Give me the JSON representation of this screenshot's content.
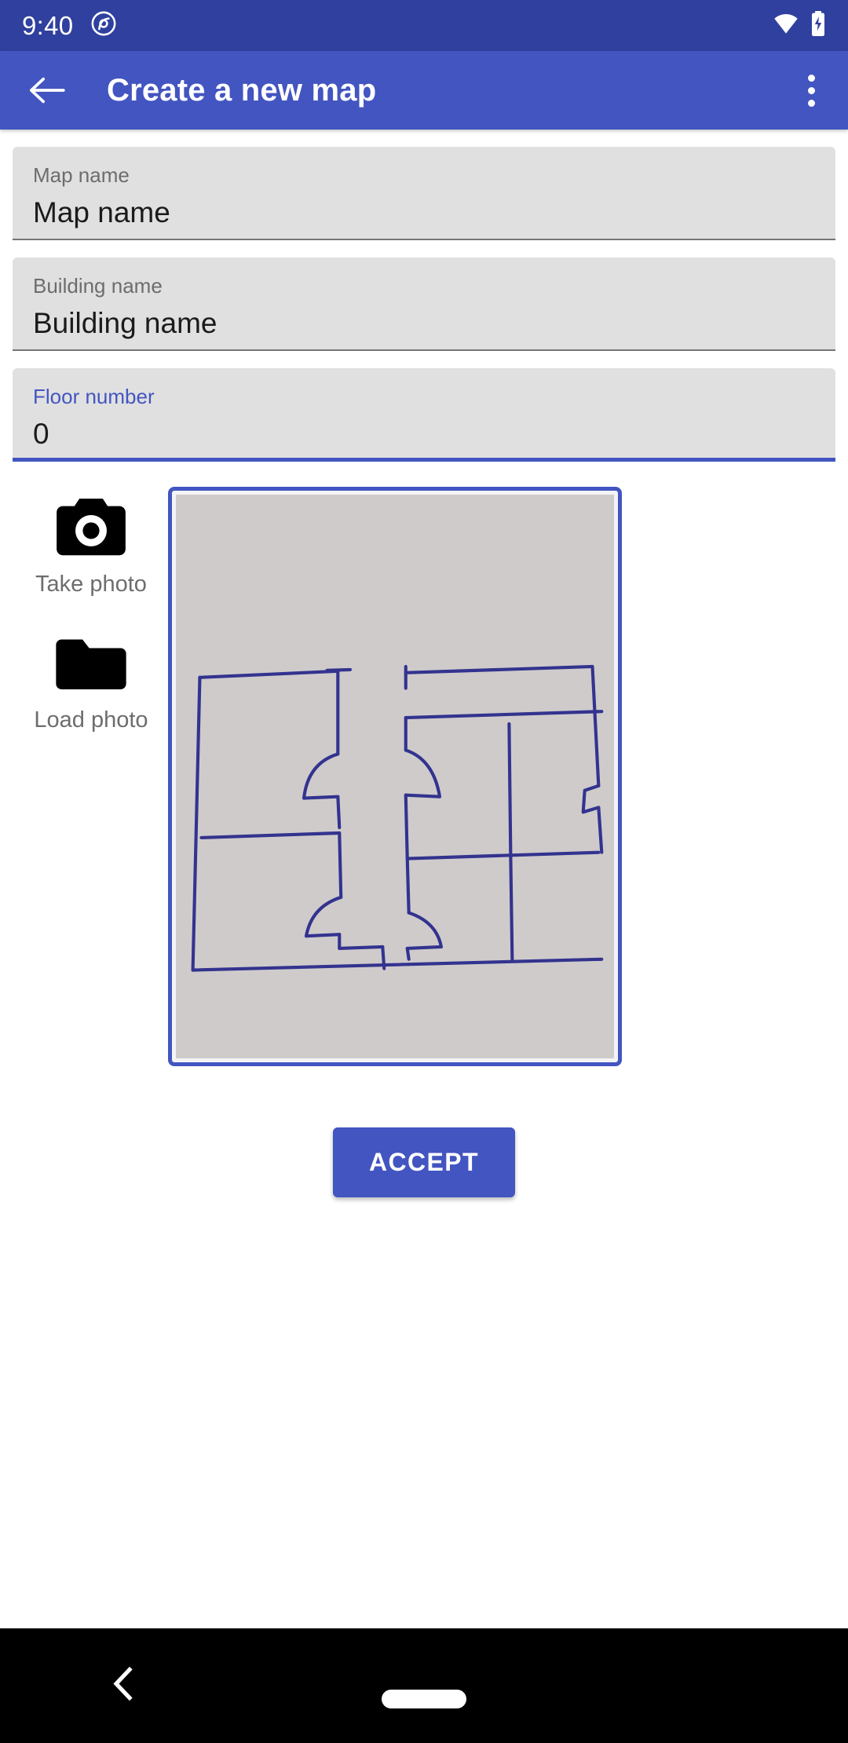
{
  "status_bar": {
    "time": "9:40",
    "left_icons": [
      "privacy-indicator-icon"
    ],
    "right_icons": [
      "wifi-icon",
      "battery-charging-icon"
    ],
    "background": "#2f409e"
  },
  "app_bar": {
    "back_icon": "arrow-left-icon",
    "title": "Create a new map",
    "overflow_icon": "more-vertical-icon",
    "background": "#4355c0"
  },
  "form": {
    "fields": [
      {
        "label": "Map name",
        "value": "Map name",
        "focused": false
      },
      {
        "label": "Building name",
        "value": "Building name",
        "focused": false
      },
      {
        "label": "Floor number",
        "value": "0",
        "focused": true
      }
    ]
  },
  "photo_actions": [
    {
      "icon": "camera-icon",
      "label": "Take photo"
    },
    {
      "icon": "folder-icon",
      "label": "Load photo"
    }
  ],
  "preview": {
    "name": "floor-plan-photo-preview",
    "alt": "Hand drawn floor plan photo",
    "border_color": "#4355c0",
    "paper_color": "#cfcbcb",
    "ink_color": "#33338f"
  },
  "accept": {
    "label": "ACCEPT",
    "color": "#4355c0"
  },
  "nav_bar": {
    "back_icon": "chevron-left-icon",
    "home_pill": "home-pill-icon",
    "background": "#000000"
  }
}
